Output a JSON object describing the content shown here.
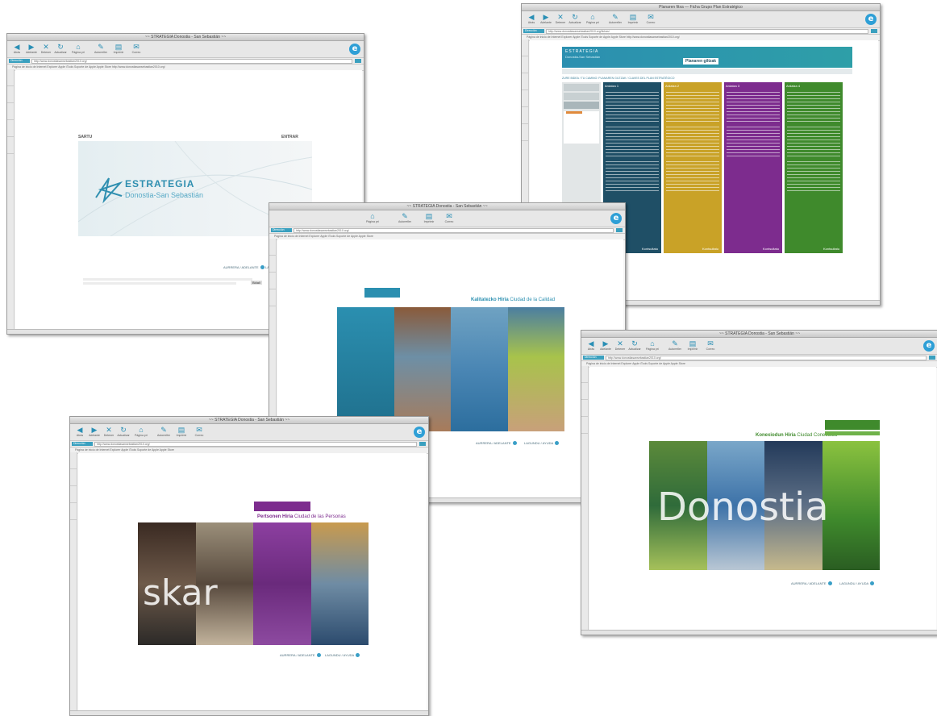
{
  "windows": [
    {
      "id": "w1",
      "title": "~~ STRATEGIA Donostia - San Sebastián ~~",
      "address_label": "Dirección",
      "url": "http://www.donostiasansebastian2010.org/",
      "favorites": "Página de inicio de Internet Explorer    Apple    iTools    Soporte de Apple    Apple Store    http://www.donostiasansebastian2010.org/",
      "content": {
        "sarto": "SARTU",
        "entrar": "ENTRAR",
        "logo_title": "ESTRATEGIA",
        "logo_sub": "Donostia-San Sebastián",
        "nav_left": "AURRERA / ADELANTE",
        "nav_right": "LAGUNDU / AYUDA",
        "footer_btn": "Bidali"
      }
    },
    {
      "id": "w2",
      "title": "Planaren fitxa — Ficha Grupo Plan Estratégico",
      "address_label": "Dirección",
      "url": "http://www.donostiasansebastian2010.org/fichas/",
      "favorites": "Página de inicio de Internet Explorer    Apple    iTools    Soporte de Apple    Apple Store    http://www.donostiasansebastian2010.org/",
      "content": {
        "brand_1": "ESTRATEGIA",
        "brand_2": "Donostia-San Sebastián",
        "header_label": "Planaren giltzak",
        "breadcrumb": "ZURE BIDEA / TU CAMINO: PLANAREN GILTZAK / CLAVES DEL PLAN ESTRATÉGICO",
        "columns": [
          "Ardatza 1",
          "Ardatza 2",
          "Ardatza 3",
          "Ardatza 4"
        ],
        "col_foot": "Kontsultatu"
      }
    },
    {
      "id": "w3",
      "title": "~~ STRATEGIA Donostia - San Sebastián ~~",
      "address_label": "Dirección",
      "url": "http://www.donostiasansebastian2010.org/",
      "favorites": "Página de inicio de Internet Explorer    Apple    iTools    Soporte de Apple    Apple Store",
      "content": {
        "tag": "Kalitatezko Hiria",
        "tag2": "Ciudad de la Calidad",
        "nav_left": "AURRERA / ADELANTE",
        "nav_right": "LAGUNDU / AYUDA"
      }
    },
    {
      "id": "w4",
      "title": "~~ STRATEGIA Donostia - San Sebastián ~~",
      "address_label": "Dirección",
      "url": "http://www.donostiasansebastian2010.org/",
      "favorites": "Página de inicio de Internet Explorer    Apple    iTools    Soporte de Apple    Apple Store",
      "content": {
        "tag": "Konexiodun Hiria",
        "tag2": "Ciudad Conectada",
        "big_word": "Donostia",
        "nav_left": "AURRERA / ADELANTE",
        "nav_right": "LAGUNDU / AYUDA"
      }
    },
    {
      "id": "w5",
      "title": "~~ STRATEGIA Donostia - San Sebastián ~~",
      "address_label": "Dirección",
      "url": "http://www.donostiasansebastian2010.org/",
      "favorites": "Página de inicio de Internet Explorer    Apple    iTools    Soporte de Apple    Apple Store",
      "content": {
        "tag": "Pertsonen Hiria",
        "tag2": "Ciudad de las Personas",
        "big_word": "skar",
        "nav_left": "AURRERA / ADELANTE",
        "nav_right": "LAGUNDU / AYUDA"
      }
    }
  ],
  "toolbar": [
    "Atrás",
    "Adelante",
    "Detener",
    "Actualizar",
    "Página principal",
    "Autorrelleno",
    "Imprimir",
    "Correo"
  ],
  "colors": {
    "teal": "#2b8fb0",
    "ochre": "#c9a227",
    "purple": "#7d2c8e",
    "green": "#3f8a2c",
    "navy": "#1f4f66"
  }
}
